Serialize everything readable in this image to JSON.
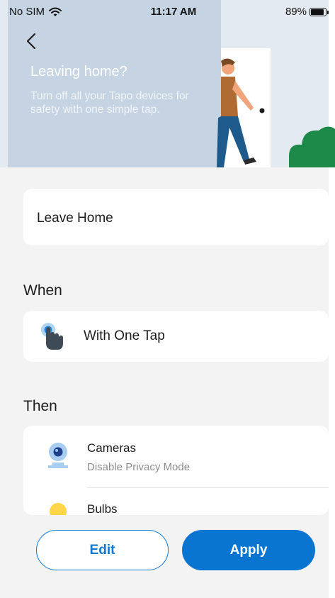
{
  "status_bar": {
    "carrier": "No SIM",
    "time": "11:17 AM",
    "battery_percent_label": "89%",
    "battery_level": 0.89
  },
  "hero": {
    "title": "Leaving home?",
    "description": "Turn off all your Tapo devices for safety with one simple tap.",
    "colors": {
      "panel": "#c5d3e3",
      "background": "#e4eaf1"
    }
  },
  "scene_name": "Leave Home",
  "when": {
    "heading": "When",
    "trigger_label": "With One Tap",
    "trigger_icon": "tap-finger-icon"
  },
  "then": {
    "heading": "Then",
    "devices": [
      {
        "name": "Cameras",
        "action": "Disable Privacy Mode",
        "icon": "camera-icon"
      },
      {
        "name": "Bulbs",
        "action": "",
        "icon": "bulb-icon"
      }
    ]
  },
  "actions": {
    "edit_label": "Edit",
    "apply_label": "Apply",
    "accent_color": "#0a74d1"
  }
}
